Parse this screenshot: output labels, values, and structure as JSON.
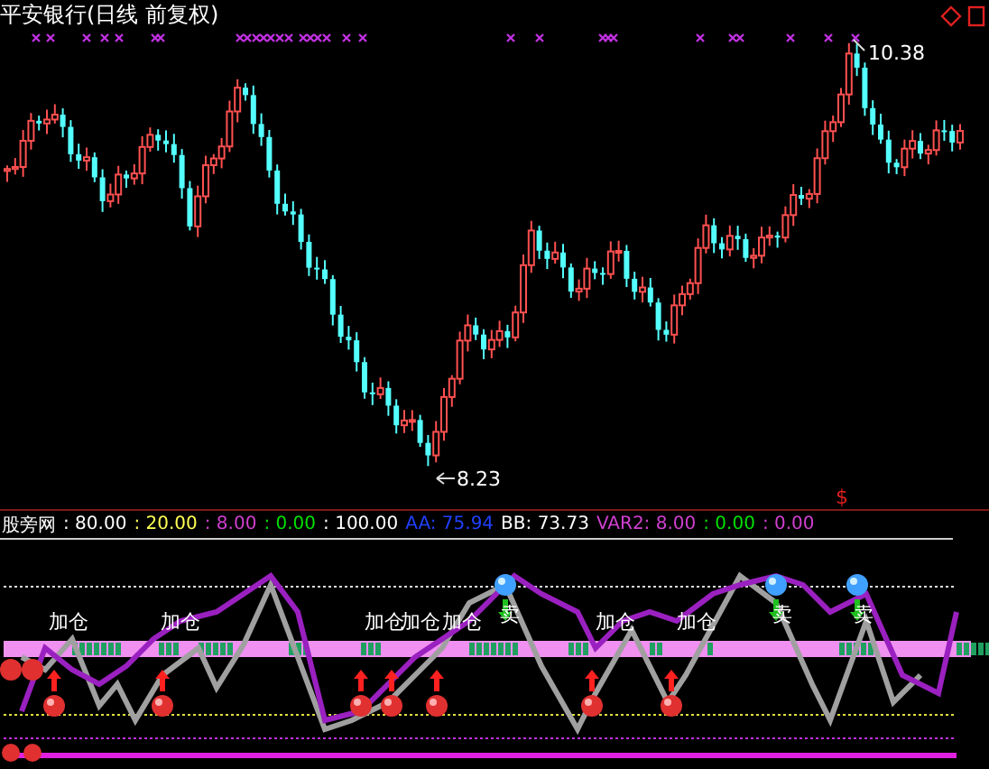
{
  "chart_title": "平安银行(日线 前复权)",
  "price_labels": [
    {
      "kind": "high",
      "text": "10.38"
    },
    {
      "kind": "low",
      "text": "8.23"
    }
  ],
  "event_marker": "$",
  "indicator": {
    "name": "股旁网",
    "values": [
      {
        "text": ": 80.00",
        "color": "#ffffff"
      },
      {
        "text": ": 20.00",
        "color": "#ffff54"
      },
      {
        "text": ": 8.00",
        "color": "#d040d0"
      },
      {
        "text": ": 0.00",
        "color": "#00e000"
      },
      {
        "text": ": 100.00",
        "color": "#ffffff"
      },
      {
        "text": "AA: 75.94",
        "color": "#2040ff"
      },
      {
        "text": "BB: 73.73",
        "color": "#ffffff"
      },
      {
        "text": "VAR2: 8.00",
        "color": "#d040d0"
      },
      {
        "text": ": 0.00",
        "color": "#00e000"
      },
      {
        "text": ": 0.00",
        "color": "#d040d0"
      }
    ]
  },
  "signals": [
    {
      "kind": "add",
      "text": "加仓"
    },
    {
      "kind": "add",
      "text": "加仓"
    },
    {
      "kind": "add",
      "text": "加仓"
    },
    {
      "kind": "add",
      "text": "加仓"
    },
    {
      "kind": "add",
      "text": "加仓"
    },
    {
      "kind": "sell",
      "text": "卖"
    },
    {
      "kind": "add",
      "text": "加仓"
    },
    {
      "kind": "add",
      "text": "加仓"
    },
    {
      "kind": "sell",
      "text": "卖"
    },
    {
      "kind": "sell",
      "text": "卖"
    }
  ]
}
